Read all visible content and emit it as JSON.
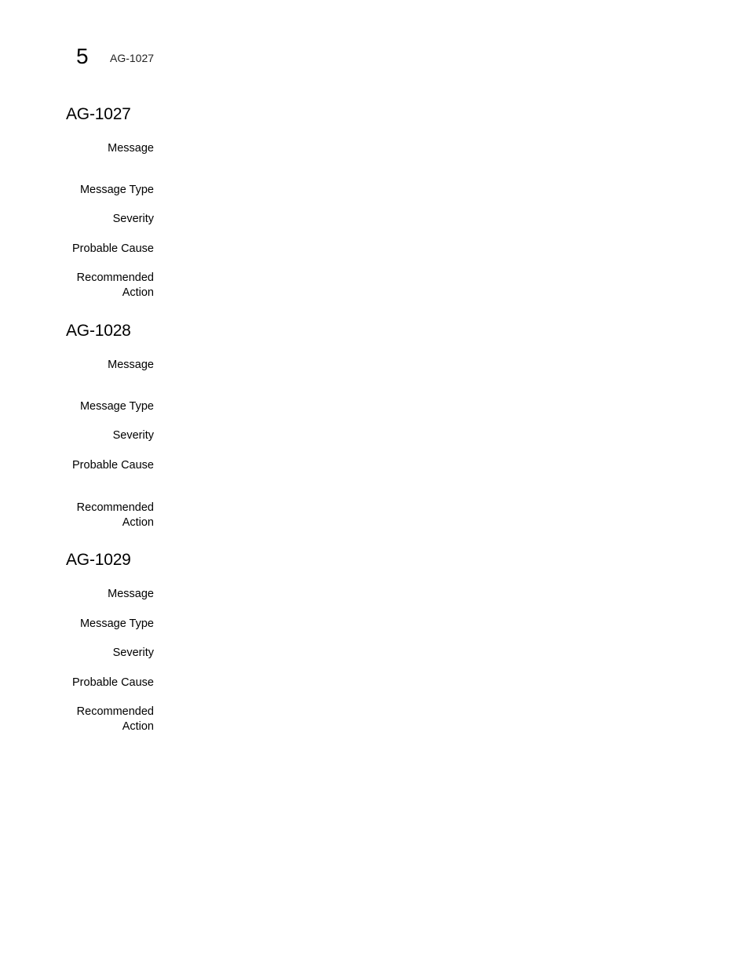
{
  "header": {
    "chapter_number": "5",
    "running_title": "AG-1027"
  },
  "sections": [
    {
      "id": "AG-1027",
      "fields": [
        {
          "label": "Message",
          "value": ""
        },
        {
          "label": "Message Type",
          "value": ""
        },
        {
          "label": "Severity",
          "value": ""
        },
        {
          "label": "Probable Cause",
          "value": ""
        },
        {
          "label": "Recommended Action",
          "label_lines": [
            "Recommended",
            "Action"
          ],
          "value": ""
        }
      ]
    },
    {
      "id": "AG-1028",
      "fields": [
        {
          "label": "Message",
          "value": ""
        },
        {
          "label": "Message Type",
          "value": ""
        },
        {
          "label": "Severity",
          "value": ""
        },
        {
          "label": "Probable Cause",
          "value": ""
        },
        {
          "label": "Recommended Action",
          "label_lines": [
            "Recommended",
            "Action"
          ],
          "value": ""
        }
      ]
    },
    {
      "id": "AG-1029",
      "fields": [
        {
          "label": "Message",
          "value": ""
        },
        {
          "label": "Message Type",
          "value": ""
        },
        {
          "label": "Severity",
          "value": ""
        },
        {
          "label": "Probable Cause",
          "value": ""
        },
        {
          "label": "Recommended Action",
          "label_lines": [
            "Recommended",
            "Action"
          ],
          "value": ""
        }
      ]
    }
  ]
}
